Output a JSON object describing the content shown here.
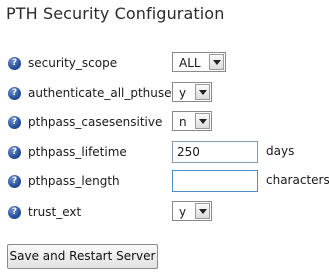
{
  "title": "PTH Security Configuration",
  "help_icon_glyph": "?",
  "fields": [
    {
      "label": "security_scope",
      "type": "select",
      "value": "ALL",
      "icon": "help-icon"
    },
    {
      "label": "authenticate_all_pthuser",
      "type": "select",
      "value": "y",
      "icon": "help-icon"
    },
    {
      "label": "pthpass_casesensitive",
      "type": "select",
      "value": "n",
      "icon": "help-icon"
    },
    {
      "label": "pthpass_lifetime",
      "type": "text",
      "value": "250",
      "unit": "days",
      "icon": "help-icon"
    },
    {
      "label": "pthpass_length",
      "type": "text",
      "value": "",
      "unit": "characters",
      "icon": "help-icon"
    },
    {
      "label": "trust_ext",
      "type": "select",
      "value": "y",
      "icon": "help-icon"
    }
  ],
  "button_label": "Save and Restart Server",
  "colors": {
    "help_icon": "#274f9c",
    "input_focus_border": "#4a8fc4"
  }
}
